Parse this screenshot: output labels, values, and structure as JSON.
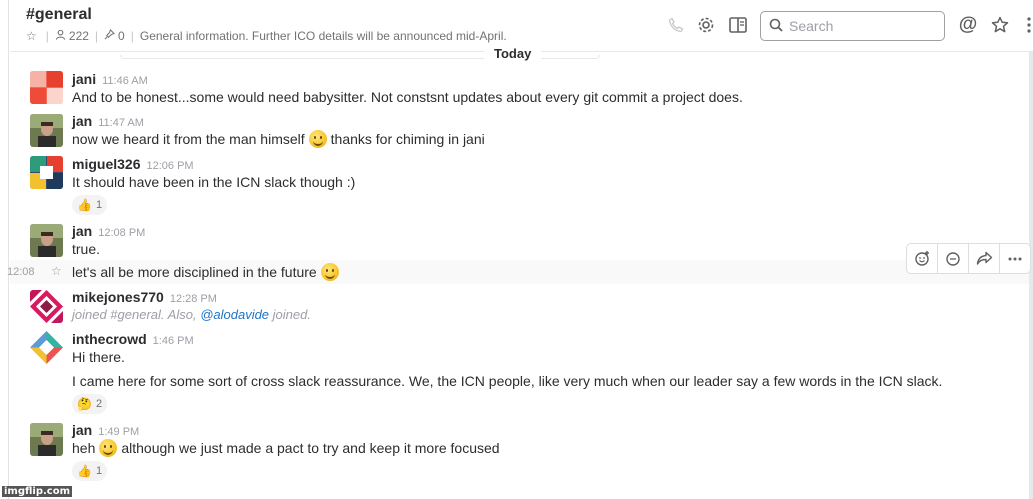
{
  "header": {
    "channel": "#general",
    "members": "222",
    "pinned": "0",
    "topic": "General information. Further ICO details will be announced mid-April.",
    "search_placeholder": "Search"
  },
  "day_divider": "Today",
  "messages": [
    {
      "author": "jani",
      "time": "11:46 AM",
      "text": "And to be honest...some would need babysitter. Not constsnt updates about every git commit a project does."
    },
    {
      "author": "jan",
      "time": "11:47 AM",
      "text_a": "now we heard it from the man himself",
      "text_b": "thanks for chiming in jani"
    },
    {
      "author": "miguel326",
      "time": "12:06 PM",
      "text": "It should have been in the ICN slack though :)",
      "reaction_count": "1"
    },
    {
      "author": "jan",
      "time": "12:08 PM",
      "text": "true."
    },
    {
      "hover_time": "12:08",
      "text": "let's all be more disciplined in the future"
    },
    {
      "author": "mikejones770",
      "time": "12:28 PM",
      "text_a": "joined #general. Also,",
      "mention": "@alodavide",
      "text_b": "joined."
    },
    {
      "author": "inthecrowd",
      "time": "1:46 PM",
      "text": "Hi there.",
      "text2": "I came here for some sort of cross slack reassurance. We, the ICN people, like very much when our leader say a few words in the ICN slack.",
      "reaction_count": "2"
    },
    {
      "author": "jan",
      "time": "1:49 PM",
      "text_a": "heh",
      "text_b": "although we just made a pact to try and keep it more focused",
      "reaction_count": "1"
    }
  ],
  "watermark": "imgflip.com",
  "colors": {
    "mention": "#1d74c5",
    "text": "#2c2d30",
    "muted": "#9e9ea6"
  }
}
